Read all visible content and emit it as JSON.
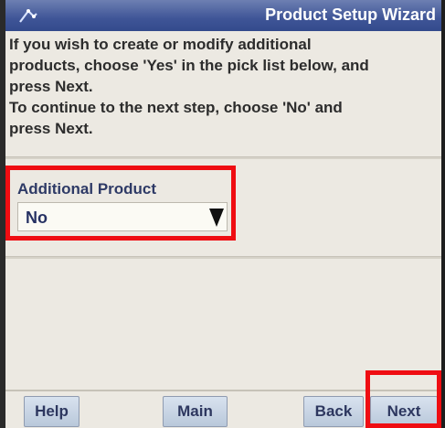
{
  "window": {
    "title": "Product Setup Wizard",
    "icon": "wizard-icon"
  },
  "instructions": {
    "line1": "If you wish to create or modify additional",
    "line2": "products, choose 'Yes' in the pick list below, and",
    "line3": "press Next.",
    "line4": "To continue to the next step, choose 'No' and",
    "line5": "press Next."
  },
  "field": {
    "label": "Additional Product",
    "selected_value": "No",
    "arrow_icon": "dropdown-arrow-icon"
  },
  "buttons": {
    "help": "Help",
    "main": "Main",
    "back": "Back",
    "next": "Next"
  },
  "colors": {
    "titlebar": "#3f5597",
    "highlight": "#ef0d12",
    "panel_background": "#ece9e2",
    "text": "#263163"
  }
}
